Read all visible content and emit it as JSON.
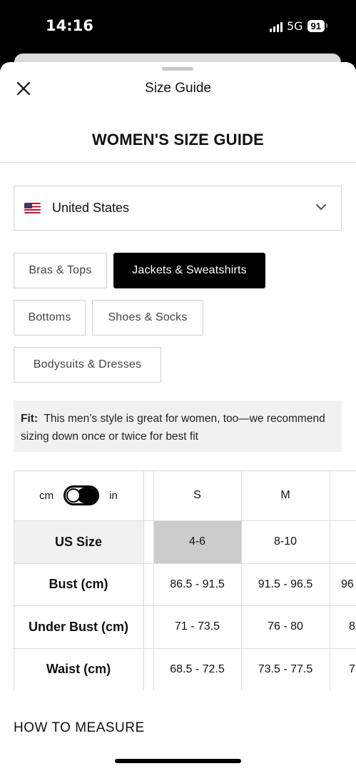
{
  "status": {
    "time": "14:16",
    "network": "5G",
    "battery": "91"
  },
  "header": {
    "title": "Size Guide",
    "close_icon": "close-icon"
  },
  "guide": {
    "title": "WOMEN'S SIZE GUIDE"
  },
  "country": {
    "selected": "United States",
    "flag_icon": "us-flag-icon"
  },
  "categories": [
    {
      "label": "Bras & Tops",
      "active": false
    },
    {
      "label": "Jackets & Sweatshirts",
      "active": true
    },
    {
      "label": "Bottoms",
      "active": false
    },
    {
      "label": "Shoes & Socks",
      "active": false
    },
    {
      "label": "Bodysuits & Dresses",
      "active": false
    }
  ],
  "fit": {
    "label": "Fit:",
    "text": "This men’s style is great for women, too—we recommend sizing down once or twice for best fit"
  },
  "units": {
    "left": "cm",
    "right": "in",
    "selected": "in"
  },
  "table": {
    "sizes": [
      "S",
      "M"
    ],
    "rows": [
      {
        "label": "US Size",
        "values": [
          "4-6",
          "8-10",
          ""
        ]
      },
      {
        "label": "Bust (cm)",
        "values": [
          "86.5 - 91.5",
          "91.5 - 96.5",
          "96"
        ]
      },
      {
        "label": "Under Bust (cm)",
        "values": [
          "71 - 73.5",
          "76 - 80",
          "8"
        ]
      },
      {
        "label": "Waist (cm)",
        "values": [
          "68.5 - 72.5",
          "73.5 - 77.5",
          "7"
        ]
      }
    ]
  },
  "measure": {
    "title": "HOW TO MEASURE"
  },
  "colors": {
    "active_bg": "#000000",
    "highlight_cell": "#cccccc",
    "header_cell": "#f1f1f1"
  }
}
